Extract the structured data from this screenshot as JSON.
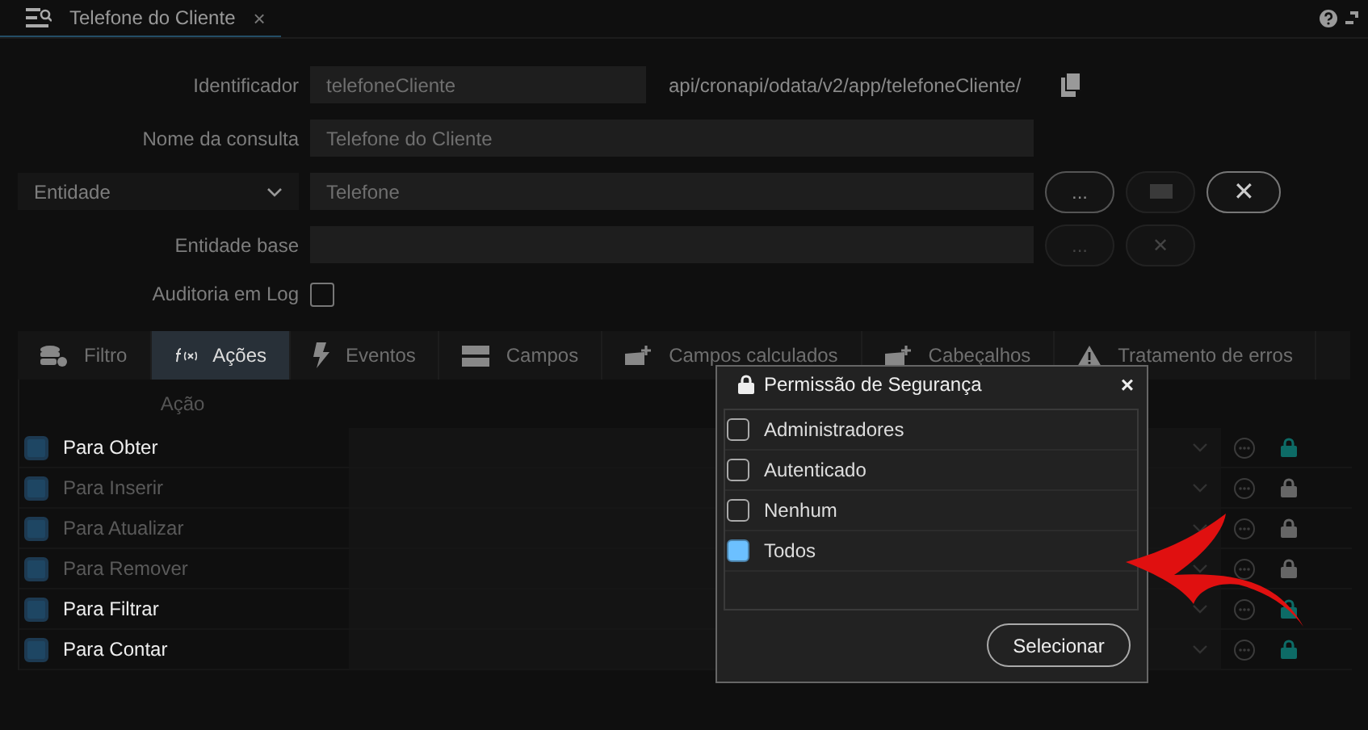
{
  "tab": {
    "title": "Telefone do Cliente",
    "close": "×"
  },
  "form": {
    "identifier_label": "Identificador",
    "identifier_value": "telefoneCliente",
    "url": "api/cronapi/odata/v2/app/telefoneCliente/",
    "query_name_label": "Nome da consulta",
    "query_name_value": "Telefone do Cliente",
    "entity_select": "Entidade",
    "entity_value": "Telefone",
    "entity_more": "...",
    "entity_clear": "✕",
    "base_entity_label": "Entidade base",
    "base_more": "...",
    "base_clear": "✕",
    "audit_label": "Auditoria em Log",
    "audit_checked": false
  },
  "sections": [
    {
      "label": "Filtro",
      "kind": "database",
      "selected": false
    },
    {
      "label": "Ações",
      "kind": "function",
      "selected": true
    },
    {
      "label": "Eventos",
      "kind": "bolt",
      "selected": false
    },
    {
      "label": "Campos",
      "kind": "bars",
      "selected": false
    },
    {
      "label": "Campos calculados",
      "kind": "addfield",
      "selected": false
    },
    {
      "label": "Cabeçalhos",
      "kind": "addfield",
      "selected": false
    },
    {
      "label": "Tratamento de erros",
      "kind": "warning",
      "selected": false
    }
  ],
  "actions": {
    "column": "Ação",
    "rows": [
      {
        "name": "Para Obter",
        "checked": true,
        "enabled": true
      },
      {
        "name": "Para Inserir",
        "checked": true,
        "enabled": false
      },
      {
        "name": "Para Atualizar",
        "checked": true,
        "enabled": false
      },
      {
        "name": "Para Remover",
        "checked": true,
        "enabled": false
      },
      {
        "name": "Para Filtrar",
        "checked": true,
        "enabled": true
      },
      {
        "name": "Para Contar",
        "checked": true,
        "enabled": true
      }
    ]
  },
  "dialog": {
    "title": "Permissão de Segurança",
    "close": "×",
    "options": [
      {
        "label": "Administradores",
        "checked": false
      },
      {
        "label": "Autenticado",
        "checked": false
      },
      {
        "label": "Nenhum",
        "checked": false
      },
      {
        "label": "Todos",
        "checked": true
      }
    ],
    "button": "Selecionar"
  }
}
